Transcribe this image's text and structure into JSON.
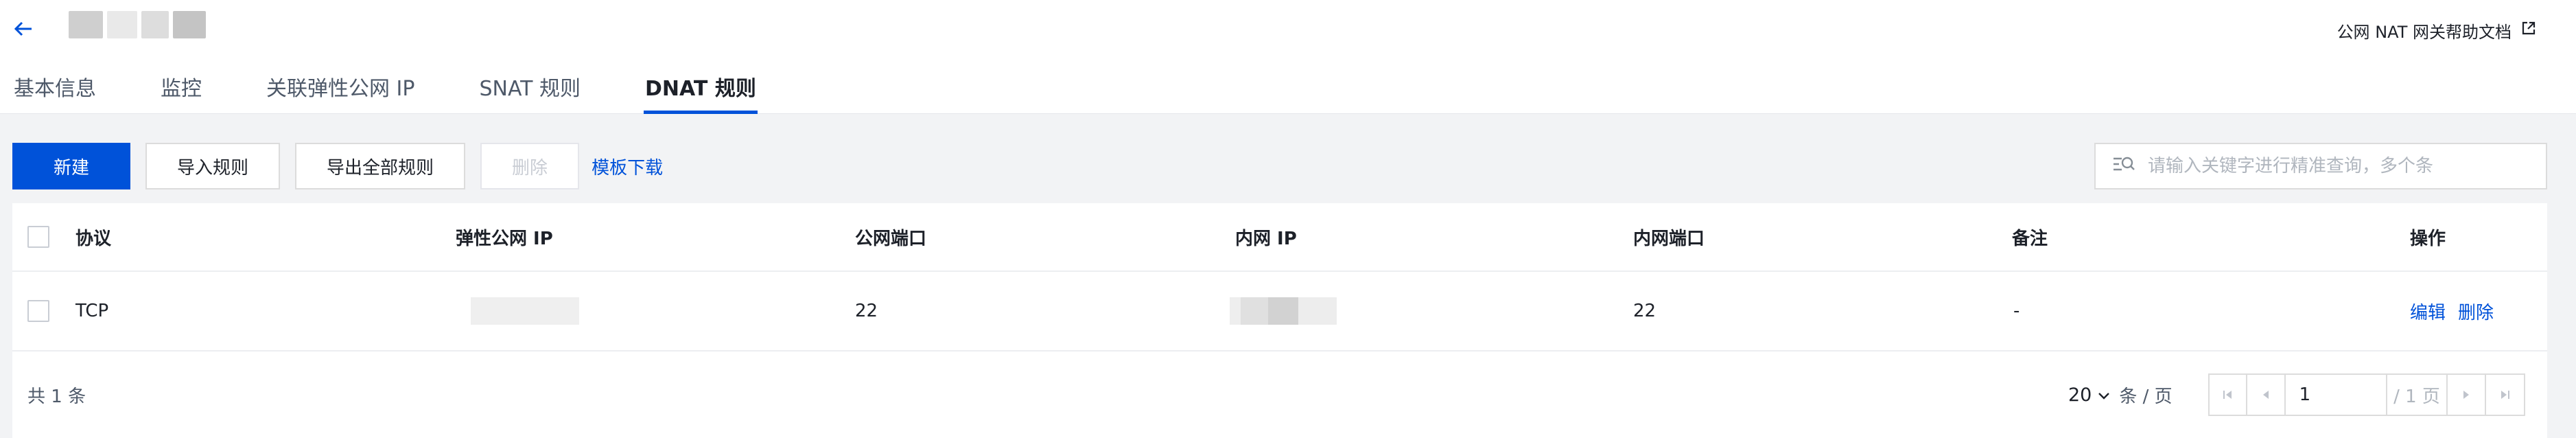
{
  "header": {
    "help_link": "公网 NAT 网关帮助文档"
  },
  "tabs": [
    {
      "label": "基本信息"
    },
    {
      "label": "监控"
    },
    {
      "label": "关联弹性公网 IP"
    },
    {
      "label": "SNAT 规则"
    },
    {
      "label": "DNAT 规则"
    }
  ],
  "toolbar": {
    "new_label": "新建",
    "import_label": "导入规则",
    "export_label": "导出全部规则",
    "delete_label": "删除",
    "template_label": "模板下载"
  },
  "search": {
    "placeholder": "请输入关键字进行精准查询，多个条"
  },
  "table": {
    "columns": [
      "协议",
      "弹性公网 IP",
      "公网端口",
      "内网 IP",
      "内网端口",
      "备注",
      "操作"
    ],
    "rows": [
      {
        "protocol": "TCP",
        "public_port": "22",
        "private_port": "22",
        "remark": "-",
        "edit": "编辑",
        "delete": "删除"
      }
    ]
  },
  "footer": {
    "total": "共 1 条",
    "page_size": "20",
    "page_size_suffix": "条 / 页",
    "current_page": "1",
    "total_pages": "/ 1 页"
  },
  "colors": {
    "primary": "#0052d9",
    "text": "#1d2129",
    "background": "#f2f3f5"
  },
  "icons": [
    "back-arrow-icon",
    "external-link-icon",
    "filter-search-icon",
    "chevron-down-icon",
    "first-page-icon",
    "prev-page-icon",
    "next-page-icon",
    "last-page-icon"
  ]
}
